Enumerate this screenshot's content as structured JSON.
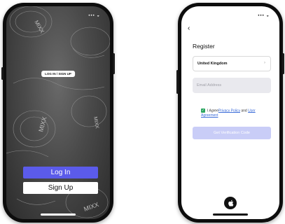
{
  "left_screen": {
    "status": "••• ◒",
    "badge_label": "LOG IN / SIGN UP",
    "login_label": "Log In",
    "signup_label": "Sign Up",
    "brand_watermark": "MIXX"
  },
  "right_screen": {
    "status": "••• ◒",
    "back": "‹",
    "title": "Register",
    "country": "United Kingdom",
    "email_placeholder": "Email Address",
    "agree_prefix": "I Agree",
    "privacy_link": "Privacy Policy",
    "agree_and": " and ",
    "user_link": "User Agreement",
    "verify_label": "Get Verification Code"
  },
  "colors": {
    "primary": "#5b5bea",
    "check_green": "#2ba55f",
    "link_blue": "#3a6bd8"
  }
}
